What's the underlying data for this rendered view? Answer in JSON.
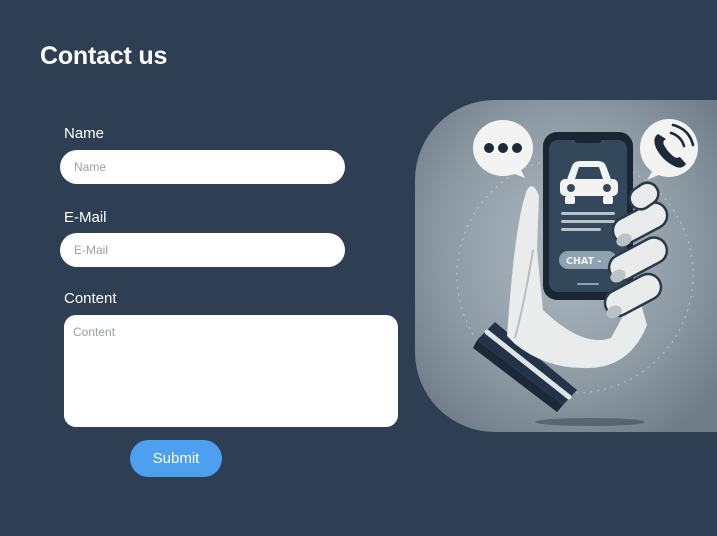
{
  "page": {
    "title": "Contact us"
  },
  "form": {
    "name": {
      "label": "Name",
      "placeholder": "Name",
      "value": ""
    },
    "email": {
      "label": "E-Mail",
      "placeholder": "E-Mail",
      "value": ""
    },
    "content": {
      "label": "Content",
      "placeholder": "Content",
      "value": ""
    },
    "submit_label": "Submit"
  },
  "illustration": {
    "screen_text": "CHAT - ",
    "icons": [
      "chat-bubble-icon",
      "phone-call-icon",
      "car-icon"
    ]
  },
  "colors": {
    "background": "#2e3f54",
    "accent": "#4d9ff0",
    "input_background": "#ffffff",
    "text": "#ffffff"
  }
}
